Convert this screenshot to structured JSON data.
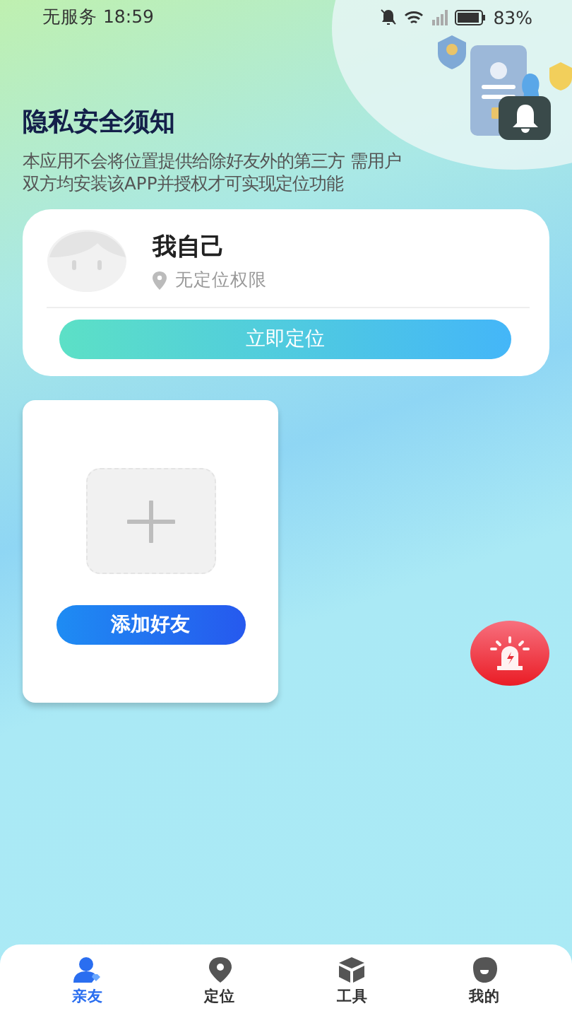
{
  "status_bar": {
    "carrier": "无服务",
    "time": "18:59",
    "battery": "83%"
  },
  "header": {
    "title": "隐私安全须知",
    "description": "本应用不会将位置提供给除好友外的第三方 需用户双方均安装该APP并授权才可实现定位功能"
  },
  "self_card": {
    "name": "我自己",
    "status": "无定位权限",
    "button": "立即定位"
  },
  "friend_card": {
    "button": "添加好友"
  },
  "nav": [
    {
      "label": "亲友",
      "selected": true
    },
    {
      "label": "定位",
      "selected": false
    },
    {
      "label": "工具",
      "selected": false
    },
    {
      "label": "我的",
      "selected": false
    }
  ]
}
